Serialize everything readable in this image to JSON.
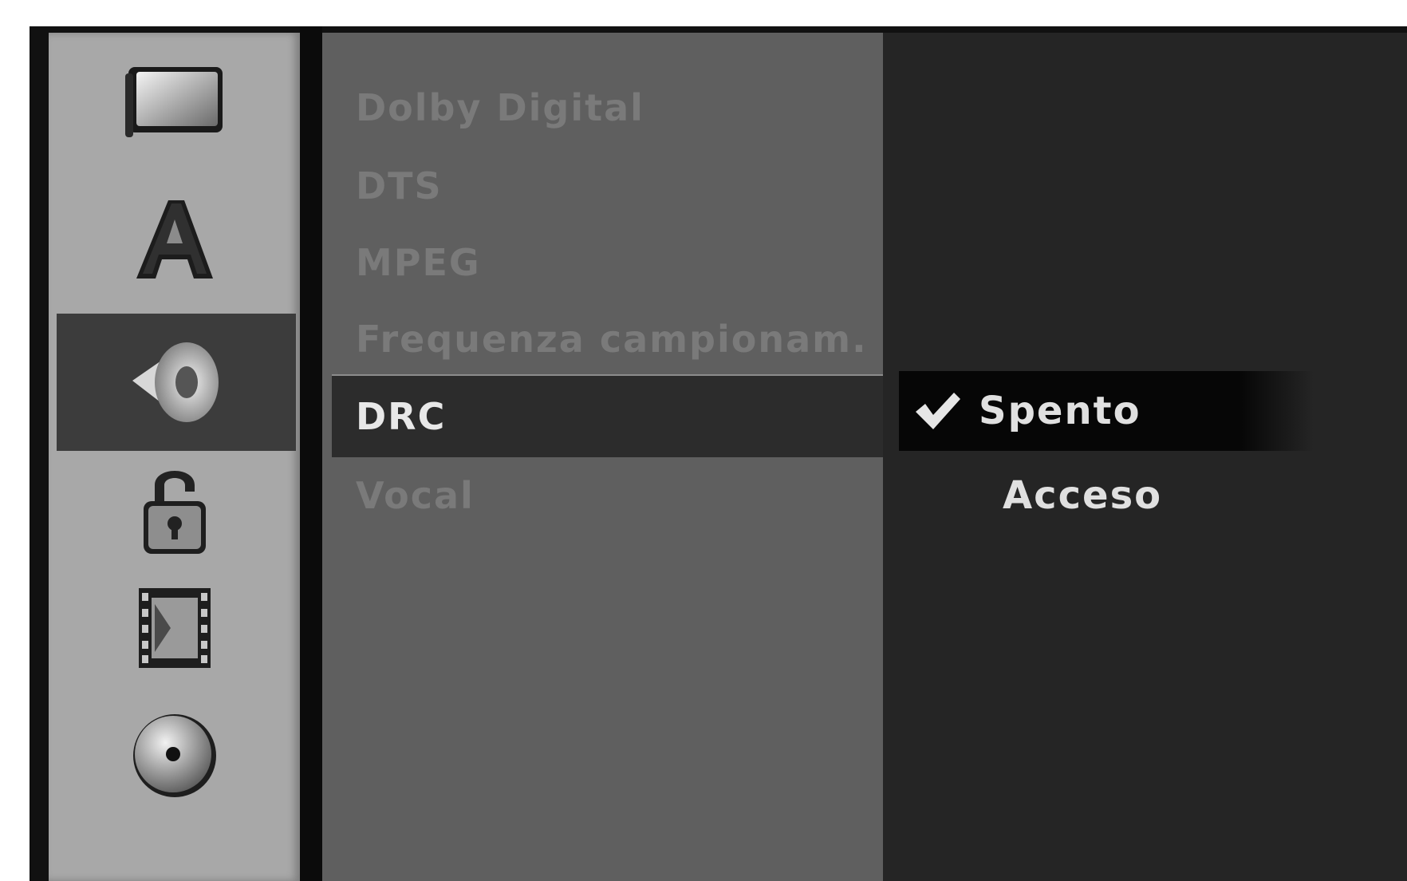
{
  "sidebar": {
    "icons": [
      {
        "name": "display-icon",
        "active": false
      },
      {
        "name": "language-icon",
        "glyph": "A",
        "active": false
      },
      {
        "name": "speaker-icon",
        "active": true
      },
      {
        "name": "lock-icon",
        "active": false
      },
      {
        "name": "film-icon",
        "active": false
      },
      {
        "name": "disc-icon",
        "active": false
      }
    ]
  },
  "menu": {
    "items": [
      {
        "label": "Dolby Digital",
        "selected": false
      },
      {
        "label": "DTS",
        "selected": false
      },
      {
        "label": "MPEG",
        "selected": false
      },
      {
        "label": "Frequenza campionam.",
        "selected": false
      },
      {
        "label": "DRC",
        "selected": true
      },
      {
        "label": "Vocal",
        "selected": false
      }
    ]
  },
  "options": {
    "items": [
      {
        "label": "Spento",
        "checked": true
      },
      {
        "label": "Acceso",
        "checked": false
      }
    ]
  },
  "colors": {
    "icon_column": "#a8a8a8",
    "menu_panel": "#5f5f5f",
    "option_panel": "#252525",
    "highlight": "#2c2c2c",
    "selected_text": "#e8e8e8",
    "dim_text": "#7a7a7a"
  }
}
